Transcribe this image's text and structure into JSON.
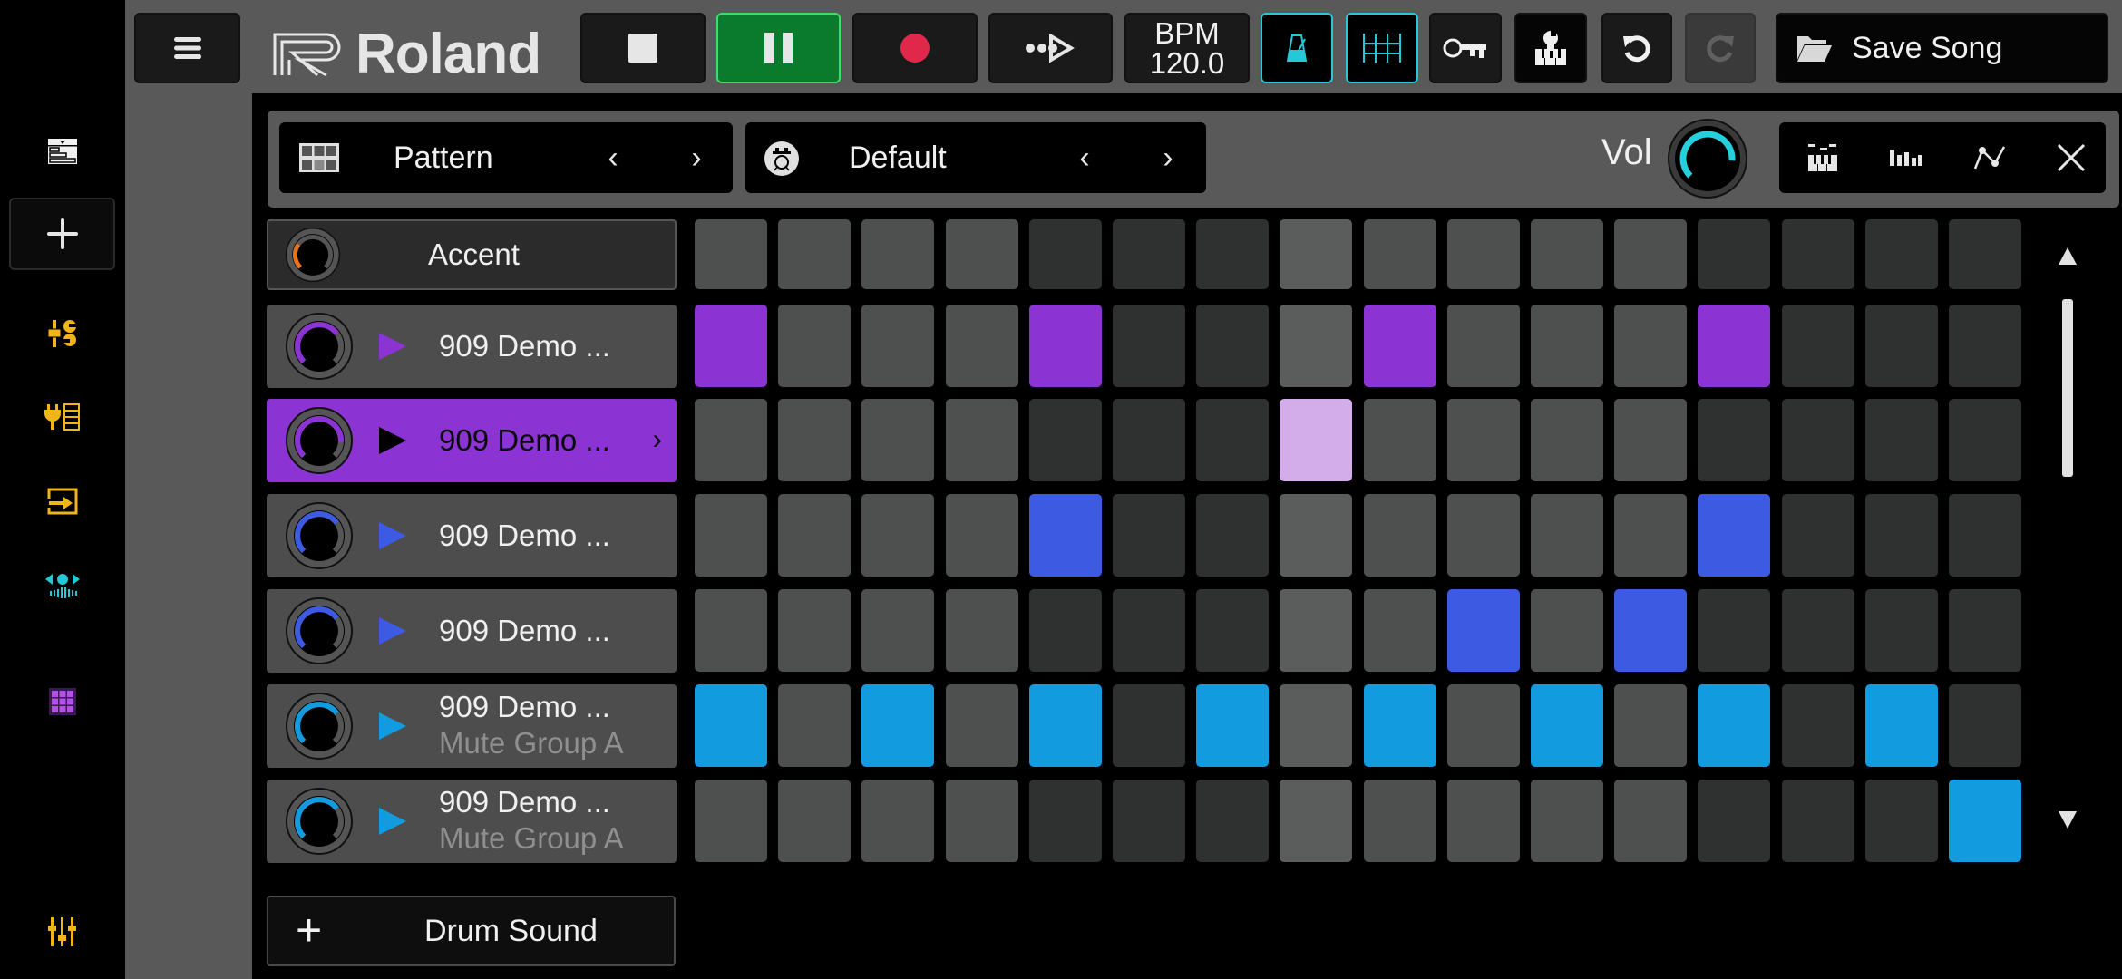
{
  "app": {
    "brand": "Roland",
    "accent_colors": {
      "play_green": "#0a7a2c",
      "record_red": "#e0284a",
      "toggle_cyan": "#24c8d6",
      "sidebar_yellow": "#f2b517",
      "purple": "#8c33d4",
      "purple_light": "#d2ade9",
      "blue": "#3d5ae3",
      "sky": "#139be0",
      "accent_orange": "#e8731f"
    }
  },
  "toolbar": {
    "menu_icon": "hamburger-menu-icon",
    "stop_icon": "stop-icon",
    "pause_icon": "pause-icon",
    "record_icon": "record-icon",
    "step_icon": "step-forward-icon",
    "bpm_label": "BPM",
    "bpm_value": "120.0",
    "metronome_icon": "metronome-icon",
    "grid_icon": "quantize-grid-icon",
    "key_icon": "key-icon",
    "piano_icon": "piano-settings-icon",
    "undo_icon": "undo-icon",
    "redo_icon": "redo-icon",
    "save_label": "Save Song",
    "save_icon": "folder-icon",
    "metronome_on": true,
    "grid_on": true,
    "redo_enabled": false
  },
  "sidebar": {
    "items": [
      {
        "name": "arrangement",
        "icon": "song-arrange-icon"
      },
      {
        "name": "add",
        "icon": "plus-icon"
      },
      {
        "name": "tools",
        "icon": "tools-icon"
      },
      {
        "name": "plugins",
        "icon": "plugin-rack-icon"
      },
      {
        "name": "import",
        "icon": "import-icon"
      },
      {
        "name": "sampler",
        "icon": "sampler-wave-icon"
      },
      {
        "name": "pads",
        "icon": "pad-grid-icon"
      },
      {
        "name": "mixer",
        "icon": "mixer-faders-icon"
      }
    ]
  },
  "subbar": {
    "pattern_label": "Pattern",
    "kit_label": "Default",
    "prev": "‹",
    "next": "›",
    "vol_label": "Vol",
    "volume": 0.85,
    "tools": [
      "piano-roll-icon",
      "velocity-bars-icon",
      "automation-icon",
      "close-icon"
    ]
  },
  "tracks": [
    {
      "name": "Accent",
      "sub": "",
      "kind": "accent",
      "color": "#e8731f",
      "level": 0.3
    },
    {
      "name": "909 Demo ...",
      "sub": "",
      "kind": "normal",
      "color": "#8c33d4",
      "level": 0.7
    },
    {
      "name": "909 Demo ...",
      "sub": "",
      "kind": "selected",
      "color": "#8c33d4",
      "level": 0.85
    },
    {
      "name": "909 Demo ...",
      "sub": "",
      "kind": "normal",
      "color": "#3d5ae3",
      "level": 0.7
    },
    {
      "name": "909 Demo ...",
      "sub": "",
      "kind": "normal",
      "color": "#3d5ae3",
      "level": 0.7
    },
    {
      "name": "909 Demo ...",
      "sub": "Mute Group A",
      "kind": "normal",
      "color": "#139be0",
      "level": 0.7
    },
    {
      "name": "909 Demo ...",
      "sub": "Mute Group A",
      "kind": "normal",
      "color": "#139be0",
      "level": 0.7
    }
  ],
  "add_sound_label": "Drum Sound",
  "grid": {
    "steps": 16,
    "column_shades": [
      "g1",
      "g1",
      "g1",
      "g1",
      "g2",
      "g2",
      "g2",
      "g3",
      "g1",
      "g1",
      "g1",
      "g1",
      "g2",
      "g2",
      "g2",
      "g2"
    ],
    "rows": [
      {
        "on": [],
        "color": "#e8731f"
      },
      {
        "on": [
          0,
          4,
          8,
          12
        ],
        "color": "#8c33d4"
      },
      {
        "on": [
          7
        ],
        "color": "#d2ade9"
      },
      {
        "on": [
          4,
          12
        ],
        "color": "#3d5ae3"
      },
      {
        "on": [
          9,
          11
        ],
        "color": "#3d5ae3"
      },
      {
        "on": [
          0,
          2,
          4,
          6,
          8,
          10,
          12,
          14
        ],
        "color": "#139be0"
      },
      {
        "on": [
          15
        ],
        "color": "#139be0"
      }
    ]
  },
  "scroll": {
    "up": "▲",
    "down": "▼"
  }
}
